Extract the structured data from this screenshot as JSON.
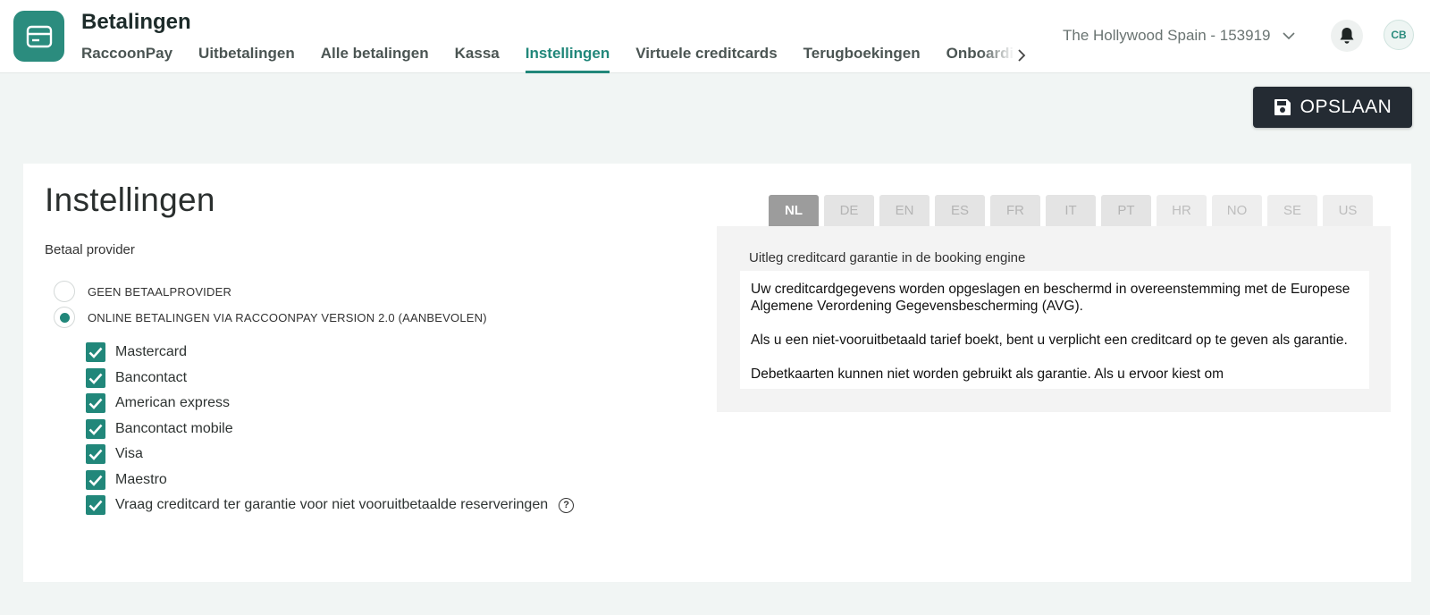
{
  "header": {
    "app_title": "Betalingen",
    "tabs": [
      {
        "label": "RaccoonPay"
      },
      {
        "label": "Uitbetalingen"
      },
      {
        "label": "Alle betalingen"
      },
      {
        "label": "Kassa"
      },
      {
        "label": "Instellingen",
        "active": true
      },
      {
        "label": "Virtuele creditcards"
      },
      {
        "label": "Terugboekingen"
      },
      {
        "label": "Onboarding"
      }
    ],
    "property": "The Hollywood Spain - 153919",
    "avatar_initials": "CB",
    "icons": {
      "logo": "credit-card-icon",
      "scroll": "chevron-right-icon",
      "dropdown": "chevron-down-icon",
      "notifications": "bell-icon"
    }
  },
  "toolbar": {
    "save_label": "OPSLAAN",
    "save_icon": "floppy-disk-icon"
  },
  "settings": {
    "title": "Instellingen",
    "provider_label": "Betaal provider",
    "radio_options": [
      {
        "label": "GEEN BETAALPROVIDER",
        "checked": false
      },
      {
        "label": "ONLINE BETALINGEN VIA RACCOONPAY VERSION 2.0 (AANBEVOLEN)",
        "checked": true
      }
    ],
    "payment_methods": [
      {
        "label": "Mastercard",
        "checked": true
      },
      {
        "label": "Bancontact",
        "checked": true
      },
      {
        "label": "American express",
        "checked": true
      },
      {
        "label": "Bancontact mobile",
        "checked": true
      },
      {
        "label": "Visa",
        "checked": true
      },
      {
        "label": "Maestro",
        "checked": true
      },
      {
        "label": "Vraag creditcard ter garantie voor niet vooruitbetaalde reserveringen",
        "checked": true,
        "help": "?"
      }
    ]
  },
  "explanation": {
    "languages": [
      "NL",
      "DE",
      "EN",
      "ES",
      "FR",
      "IT",
      "PT",
      "HR",
      "NO",
      "SE",
      "US"
    ],
    "active_language": "NL",
    "label": "Uitleg creditcard garantie in de booking engine",
    "paragraphs": [
      "Uw creditcardgegevens worden opgeslagen en beschermd in overeenstemming met de Europese Algemene Verordening Gegevensbescherming (AVG).",
      "Als u een niet-vooruitbetaald tarief boekt, bent u verplicht een creditcard op te geven als garantie.",
      "Debetkaarten kunnen niet worden gebruikt als garantie. Als u ervoor kiest om"
    ]
  },
  "colors": {
    "accent": "#21877a",
    "logo_bg": "#2b8c7e",
    "save_bg": "#242b33"
  }
}
